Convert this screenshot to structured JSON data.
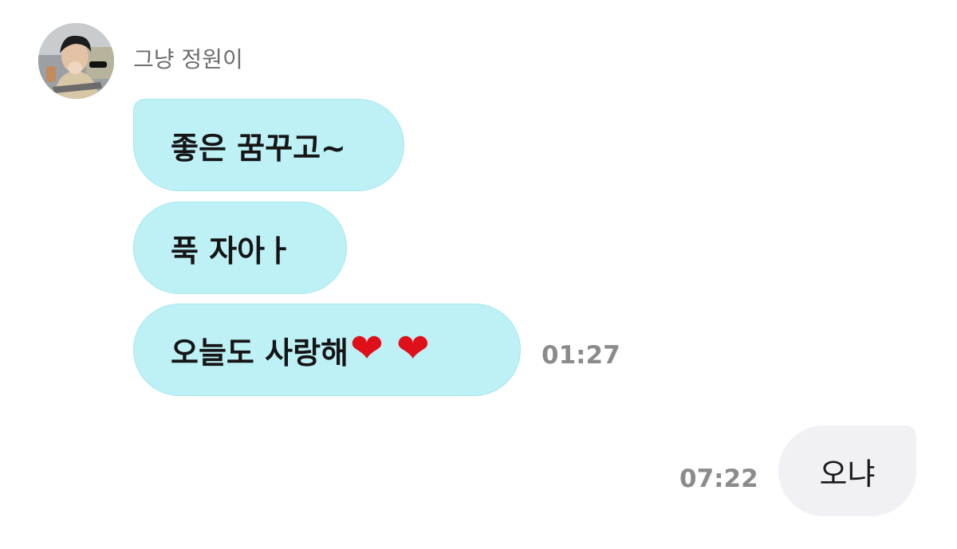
{
  "sender": {
    "name": "그냥 정원이",
    "avatar": "avatar-photo"
  },
  "incoming": {
    "messages": [
      {
        "text": "좋은 꿈꾸고~"
      },
      {
        "text": "푹 자아ㅏ"
      },
      {
        "text": "오늘도 사랑해",
        "emoji": [
          "❤",
          "❤"
        ]
      }
    ],
    "time": "01:27"
  },
  "outgoing": {
    "messages": [
      {
        "text": "오냐"
      }
    ],
    "time": "07:22"
  },
  "colors": {
    "incoming_bubble": "#bdf1f6",
    "outgoing_bubble": "#f1f1f5",
    "timestamp": "#8b8b8b",
    "heart": "#e0101a"
  }
}
